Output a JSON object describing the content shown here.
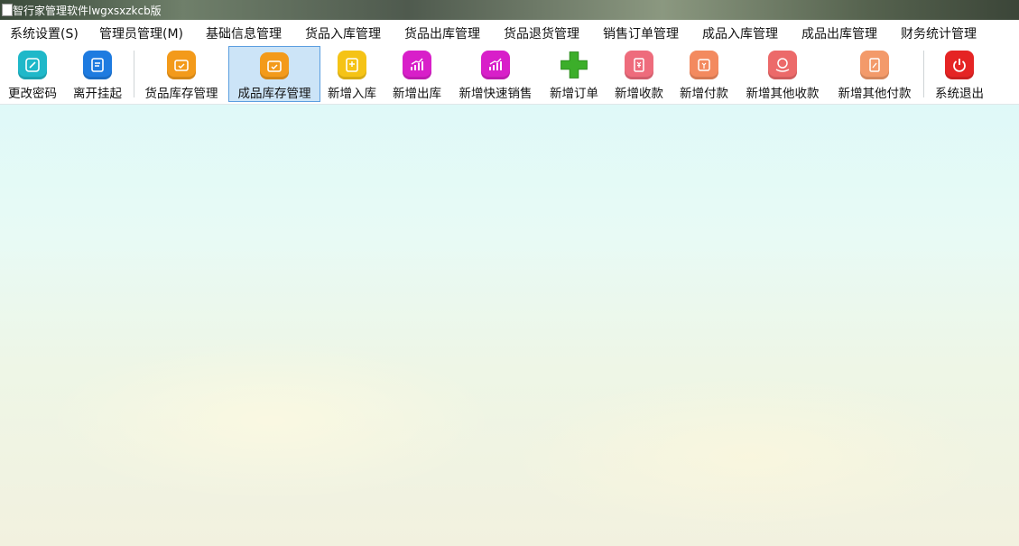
{
  "window": {
    "title": "智行家管理软件lwgxsxzkcb版"
  },
  "menu": [
    {
      "label": "系统设置(S)"
    },
    {
      "label": "管理员管理(M)"
    },
    {
      "label": "基础信息管理"
    },
    {
      "label": "货品入库管理"
    },
    {
      "label": "货品出库管理"
    },
    {
      "label": "货品退货管理"
    },
    {
      "label": "销售订单管理"
    },
    {
      "label": "成品入库管理"
    },
    {
      "label": "成品出库管理"
    },
    {
      "label": "财务统计管理"
    }
  ],
  "toolbar": [
    {
      "label": "更改密码",
      "icon": "edit-icon",
      "color": "#1fb8c9"
    },
    {
      "label": "离开挂起",
      "icon": "document-icon",
      "color": "#1e7be0"
    },
    {
      "label": "货品库存管理",
      "icon": "inventory-box-icon",
      "color": "#f39a1a"
    },
    {
      "label": "成品库存管理",
      "icon": "inventory-box-icon",
      "color": "#f39a1a",
      "active": true
    },
    {
      "label": "新增入库",
      "icon": "add-document-icon",
      "color": "#f5c316"
    },
    {
      "label": "新增出库",
      "icon": "growth-chart-icon",
      "color": "#d81fc9"
    },
    {
      "label": "新增快速销售",
      "icon": "growth-chart-icon",
      "color": "#d81fc9"
    },
    {
      "label": "新增订单",
      "icon": "plus-icon",
      "color": "#3cae2a"
    },
    {
      "label": "新增收款",
      "icon": "receipt-icon",
      "color": "#ee6c7c"
    },
    {
      "label": "新增付款",
      "icon": "payment-icon",
      "color": "#f38a5f"
    },
    {
      "label": "新增其他收款",
      "icon": "money-hand-icon",
      "color": "#ec6a6a"
    },
    {
      "label": "新增其他付款",
      "icon": "pay-document-icon",
      "color": "#f39a6a"
    },
    {
      "label": "系统退出",
      "icon": "power-icon",
      "color": "#e52424"
    }
  ]
}
